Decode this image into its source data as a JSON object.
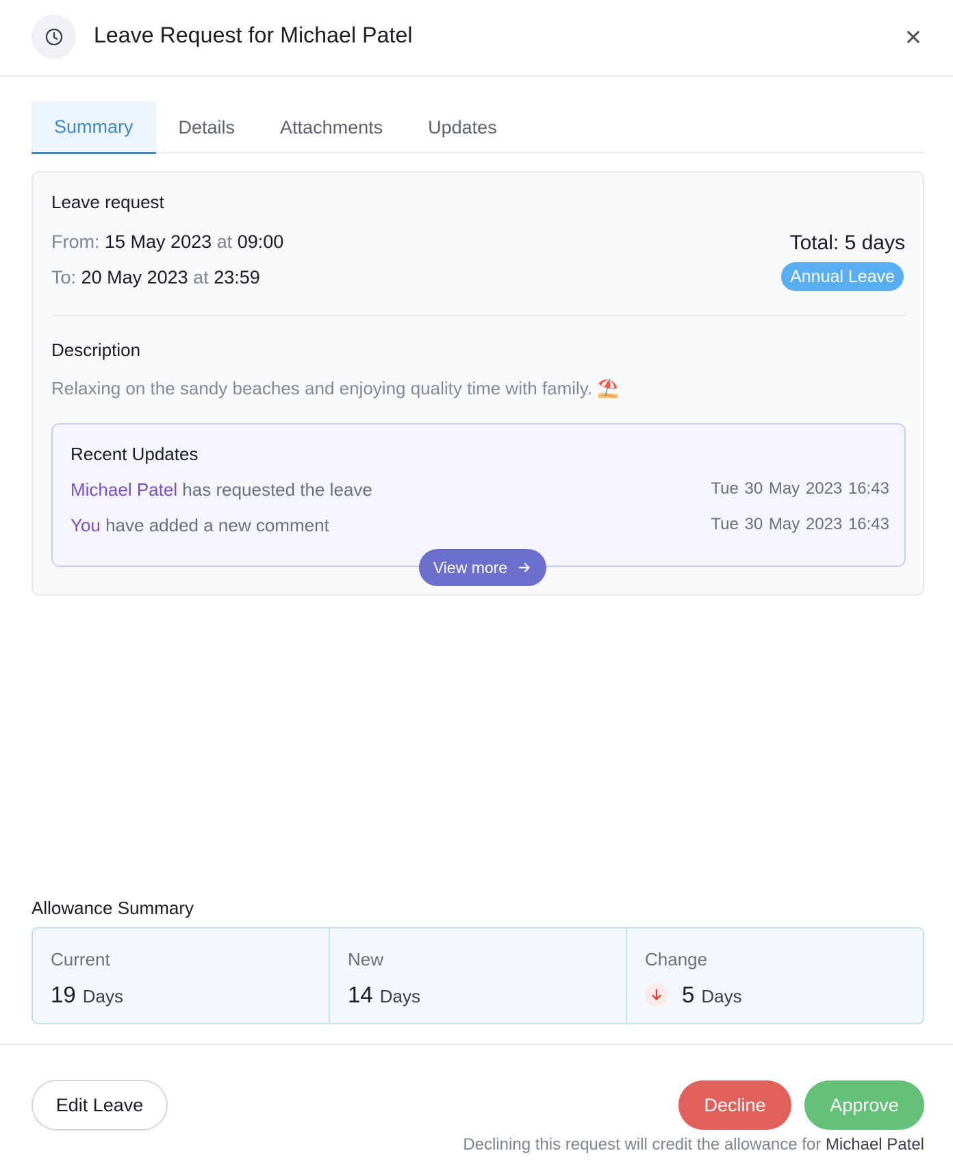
{
  "header": {
    "title": "Leave Request for Michael Patel",
    "icon": "clock-icon",
    "close_icon": "close-icon"
  },
  "tabs": [
    {
      "label": "Summary",
      "active": true
    },
    {
      "label": "Details",
      "active": false
    },
    {
      "label": "Attachments",
      "active": false
    },
    {
      "label": "Updates",
      "active": false
    }
  ],
  "leave": {
    "title": "Leave request",
    "from_label": "From:",
    "from_date": "15 May 2023",
    "from_at": "at",
    "from_time": "09:00",
    "to_label": "To:",
    "to_date": "20 May 2023",
    "to_at": "at",
    "to_time": "23:59",
    "total": "Total: 5 days",
    "type_badge": "Annual Leave",
    "description_title": "Description",
    "description": "Relaxing on the sandy beaches and enjoying quality time with family. ⛱️"
  },
  "recent_updates": {
    "title": "Recent Updates",
    "items": [
      {
        "who": "Michael Patel",
        "text": " has requested the leave",
        "when": "Tue 30 May 2023  16:43"
      },
      {
        "who": "You",
        "text": " have added a new comment",
        "when": "Tue 30 May 2023  16:43"
      }
    ],
    "view_more": "View more"
  },
  "allowance": {
    "title": "Allowance Summary",
    "current_label": "Current",
    "current_value": "19",
    "current_unit": "Days",
    "new_label": "New",
    "new_value": "14",
    "new_unit": "Days",
    "change_label": "Change",
    "change_value": "5",
    "change_unit": "Days",
    "change_icon": "arrow-down-icon"
  },
  "footer": {
    "edit_label": "Edit Leave",
    "decline_label": "Decline",
    "approve_label": "Approve",
    "note_prefix": "Declining this request will credit the allowance for ",
    "note_name": "Michael Patel"
  },
  "colors": {
    "accent": "#3f86c7",
    "badge": "#58aef0",
    "update_name": "#7a4fc7",
    "view_more": "#6d6fcd",
    "decline": "#e0605c",
    "approve": "#65c079"
  }
}
